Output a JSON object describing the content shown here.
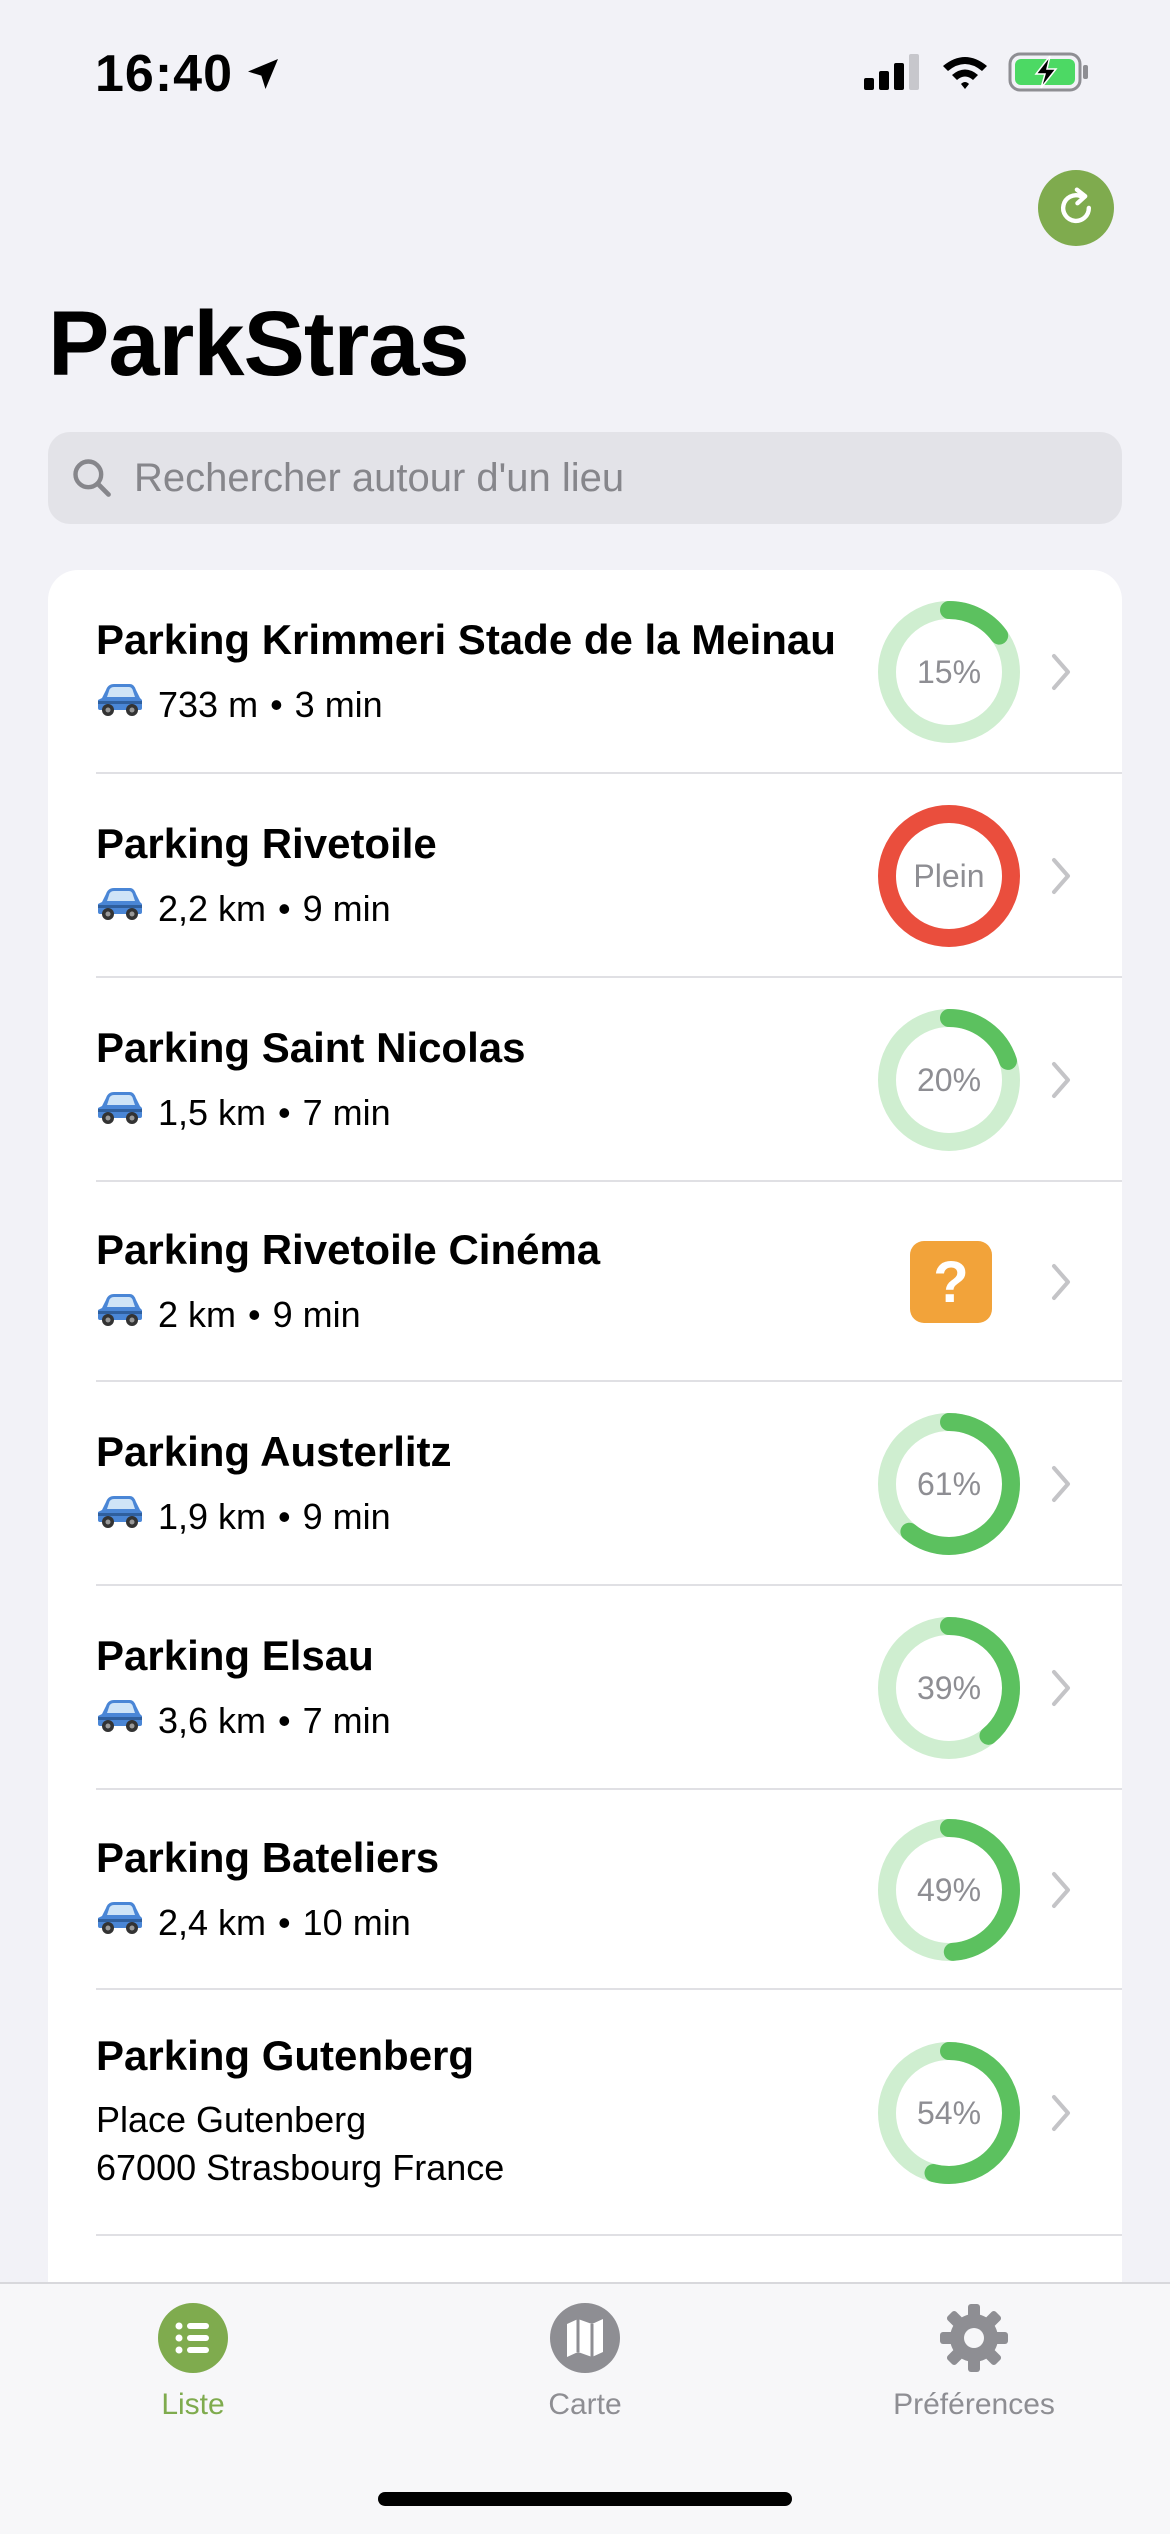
{
  "status_bar": {
    "time": "16:40",
    "icons": [
      "location-arrow-icon",
      "signal-icon",
      "wifi-icon",
      "battery-charging-icon"
    ]
  },
  "header": {
    "title": "ParkStras",
    "refresh_icon": "refresh-icon"
  },
  "search": {
    "placeholder": "Rechercher autour d'un lieu",
    "icon": "search-icon"
  },
  "colors": {
    "accent": "#7fab4e",
    "green": "#5cc15f",
    "green_light": "#cfeed0",
    "red": "#ea4e3d",
    "orange": "#f2a33a",
    "chevron": "#c4c4c7",
    "tab_inactive": "#8e8e93"
  },
  "parkings": [
    {
      "name": "Parking Krimmeri Stade de la Meinau",
      "distance": "733 m",
      "duration": "3 min",
      "status": "15%",
      "fill": 0.15,
      "state": "normal"
    },
    {
      "name": "Parking Rivetoile",
      "distance": "2,2 km",
      "duration": "9 min",
      "status": "Plein",
      "fill": 1.0,
      "state": "full"
    },
    {
      "name": "Parking Saint Nicolas",
      "distance": "1,5 km",
      "duration": "7 min",
      "status": "20%",
      "fill": 0.2,
      "state": "normal"
    },
    {
      "name": "Parking Rivetoile Cinéma",
      "distance": "2 km",
      "duration": "9 min",
      "status": "?",
      "fill": null,
      "state": "unknown"
    },
    {
      "name": "Parking Austerlitz",
      "distance": "1,9 km",
      "duration": "9 min",
      "status": "61%",
      "fill": 0.61,
      "state": "normal"
    },
    {
      "name": "Parking Elsau",
      "distance": "3,6 km",
      "duration": "7 min",
      "status": "39%",
      "fill": 0.39,
      "state": "normal"
    },
    {
      "name": "Parking Bateliers",
      "distance": "2,4 km",
      "duration": "10 min",
      "status": "49%",
      "fill": 0.49,
      "state": "normal"
    },
    {
      "name": "Parking Gutenberg",
      "address_line1": "Place Gutenberg",
      "address_line2": "67000 Strasbourg France",
      "status": "54%",
      "fill": 0.54,
      "state": "normal"
    }
  ],
  "separator": "•",
  "tabs": [
    {
      "label": "Liste",
      "icon": "list-icon",
      "active": true
    },
    {
      "label": "Carte",
      "icon": "map-icon",
      "active": false
    },
    {
      "label": "Préférences",
      "icon": "gear-icon",
      "active": false
    }
  ]
}
